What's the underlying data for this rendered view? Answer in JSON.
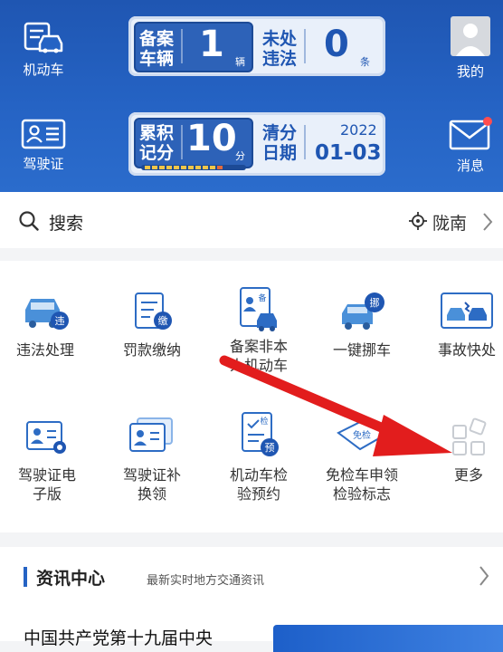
{
  "header": {
    "motor_vehicle_label": "机动车",
    "license_label": "驾驶证",
    "mine_label": "我的",
    "message_label": "消息",
    "card1": {
      "registered_label_1": "备案",
      "registered_label_2": "车辆",
      "registered_value": "1",
      "registered_unit": "辆",
      "violation_label_1": "未处",
      "violation_label_2": "违法",
      "violation_value": "0",
      "violation_unit": "条"
    },
    "card2": {
      "points_label_1": "累积",
      "points_label_2": "记分",
      "points_value": "10",
      "points_unit": "分",
      "clear_label_1": "清分",
      "clear_label_2": "日期",
      "clear_year": "2022",
      "clear_date": "01-03"
    },
    "colors": {
      "header_bg": "#2563c4",
      "message_dot": "#ff4d4f"
    }
  },
  "search": {
    "label": "搜索",
    "location": "陇南"
  },
  "services": [
    {
      "label": "违法处理",
      "icon": "car-violation-icon"
    },
    {
      "label": "罚款缴纳",
      "icon": "fine-payment-icon"
    },
    {
      "label": "备案非本人机动车",
      "icon": "register-vehicle-icon"
    },
    {
      "label": "一键挪车",
      "icon": "move-car-icon"
    },
    {
      "label": "事故快处",
      "icon": "accident-icon"
    },
    {
      "label": "驾驶证电子版",
      "icon": "e-license-icon"
    },
    {
      "label": "驾驶证补换领",
      "icon": "license-replace-icon"
    },
    {
      "label": "机动车检验预约",
      "icon": "inspection-appointment-icon"
    },
    {
      "label": "免检车申领检验标志",
      "icon": "exempt-sticker-icon"
    },
    {
      "label": "更多",
      "icon": "more-icon"
    }
  ],
  "services_display": {
    "s0": "违法处理",
    "s1": "罚款缴纳",
    "s2a": "备案非本",
    "s2b": "人机动车",
    "s3": "一键挪车",
    "s4": "事故快处",
    "s5a": "驾驶证电",
    "s5b": "子版",
    "s6a": "驾驶证补",
    "s6b": "换领",
    "s7a": "机动车检",
    "s7b": "验预约",
    "s8a": "免检车申领",
    "s8b": "检验标志",
    "s9": "更多"
  },
  "news": {
    "title": "资讯中心",
    "subtitle": "最新实时地方交通资讯",
    "first_article": "中国共产党第十九届中央"
  }
}
